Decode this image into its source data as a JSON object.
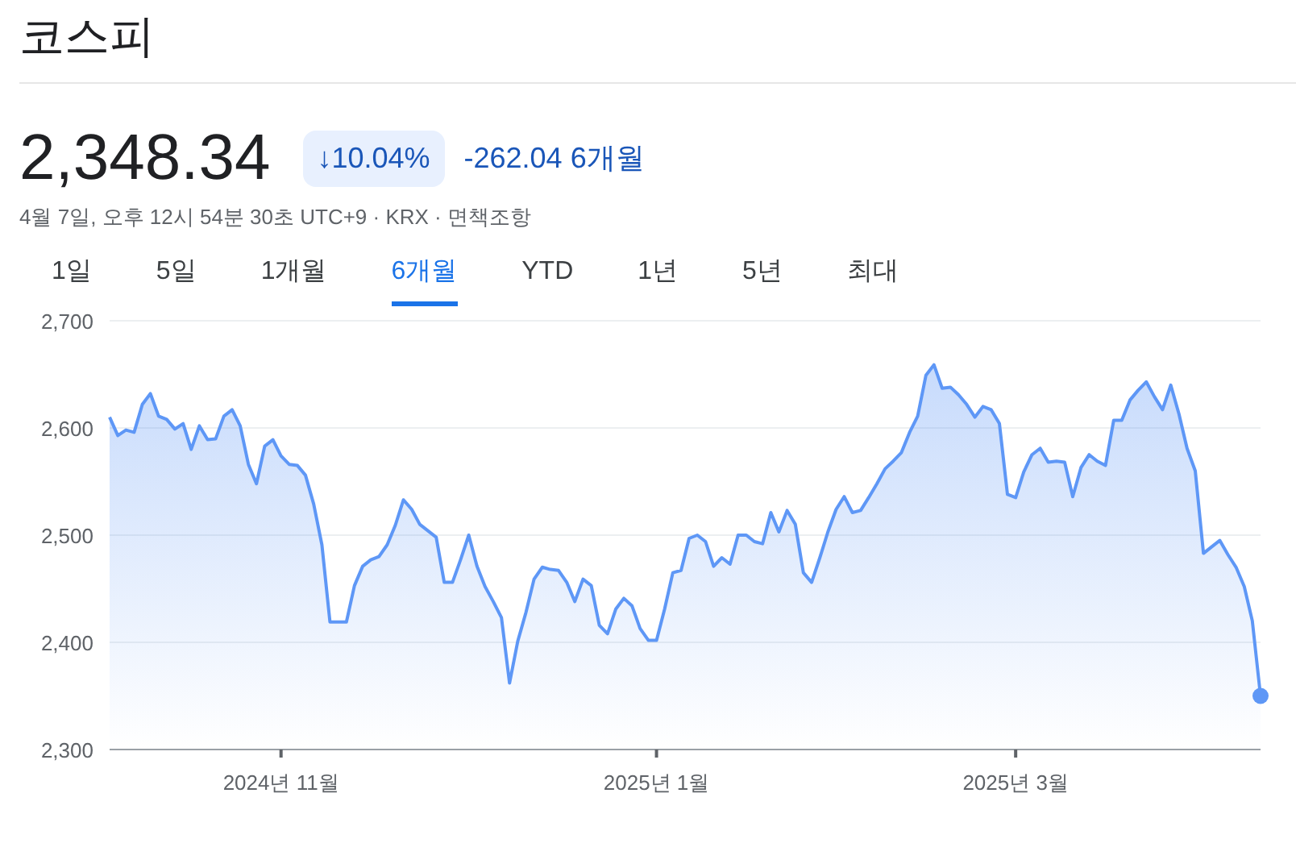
{
  "title": "코스피",
  "price": "2,348.34",
  "change_badge": {
    "arrow": "↓",
    "percent": "10.04%"
  },
  "change": "-262.04 6개월",
  "meta": "4월 7일, 오후 12시 54분 30초 UTC+9 · KRX · 면책조항",
  "tabs": [
    {
      "label": "1일",
      "selected": false
    },
    {
      "label": "5일",
      "selected": false
    },
    {
      "label": "1개월",
      "selected": false
    },
    {
      "label": "6개월",
      "selected": true
    },
    {
      "label": "YTD",
      "selected": false
    },
    {
      "label": "1년",
      "selected": false
    },
    {
      "label": "5년",
      "selected": false
    },
    {
      "label": "최대",
      "selected": false
    }
  ],
  "chart": {
    "chart_data": {
      "type": "area",
      "categories": [
        null,
        null,
        null,
        null,
        null,
        null,
        null,
        null,
        null,
        null,
        null,
        null,
        null,
        null,
        null,
        null,
        null,
        null,
        null,
        null,
        null,
        "2024년 11월",
        null,
        null,
        null,
        null,
        null,
        null,
        null,
        null,
        null,
        null,
        null,
        null,
        null,
        null,
        null,
        null,
        null,
        null,
        null,
        null,
        null,
        null,
        null,
        null,
        null,
        null,
        null,
        null,
        null,
        null,
        null,
        null,
        null,
        null,
        null,
        null,
        null,
        null,
        null,
        null,
        null,
        null,
        null,
        null,
        null,
        "2025년 1월",
        null,
        null,
        null,
        null,
        null,
        null,
        null,
        null,
        null,
        null,
        null,
        null,
        null,
        null,
        null,
        null,
        null,
        null,
        null,
        null,
        null,
        null,
        null,
        null,
        null,
        null,
        null,
        null,
        null,
        null,
        null,
        null,
        null,
        null,
        null,
        null,
        null,
        null,
        null,
        null,
        null,
        null,
        null,
        "2025년 3월",
        null,
        null,
        null,
        null,
        null,
        null,
        null,
        null,
        null,
        null,
        null,
        null,
        null,
        null,
        null,
        null,
        null,
        null,
        null,
        null,
        null,
        null,
        null,
        null,
        null,
        null,
        null,
        null,
        null,
        null
      ],
      "grid": true,
      "ylim": [
        2300,
        2700
      ],
      "yticks": [
        {
          "value": 2300,
          "label": "2,300"
        },
        {
          "value": 2400,
          "label": "2,400"
        },
        {
          "value": 2500,
          "label": "2,500"
        },
        {
          "value": 2600,
          "label": "2,600"
        },
        {
          "value": 2700,
          "label": "2,700"
        }
      ],
      "series": [
        {
          "color": "#5e97f6",
          "values": [
            2610,
            2593,
            2598,
            2596,
            2622,
            2632,
            2611,
            2608,
            2599,
            2604,
            2580,
            2602,
            2589,
            2590,
            2611,
            2617,
            2602,
            2566,
            2548,
            2583,
            2589,
            2574,
            2566,
            2565,
            2556,
            2529,
            2491,
            2419,
            2419,
            2419,
            2453,
            2471,
            2477,
            2480,
            2491,
            2509,
            2533,
            2524,
            2510,
            2504,
            2498,
            2456,
            2456,
            2477,
            2500,
            2471,
            2452,
            2438,
            2423,
            2362,
            2401,
            2428,
            2459,
            2470,
            2468,
            2467,
            2456,
            2438,
            2459,
            2453,
            2416,
            2408,
            2431,
            2441,
            2434,
            2413,
            2402,
            2402,
            2431,
            2465,
            2467,
            2497,
            2500,
            2494,
            2471,
            2479,
            2473,
            2500,
            2500,
            2494,
            2492,
            2521,
            2503,
            2523,
            2510,
            2465,
            2456,
            2479,
            2503,
            2524,
            2536,
            2521,
            2523,
            2535,
            2548,
            2562,
            2569,
            2577,
            2596,
            2611,
            2649,
            2659,
            2637,
            2638,
            2631,
            2622,
            2610,
            2620,
            2617,
            2604,
            2538,
            2535,
            2559,
            2575,
            2581,
            2568,
            2569,
            2568,
            2536,
            2563,
            2575,
            2569,
            2565,
            2607,
            2607,
            2626,
            2635,
            2643,
            2629,
            2617,
            2640,
            2613,
            2581,
            2560,
            2483,
            2489,
            2495,
            2482,
            2470,
            2452,
            2420,
            2350
          ]
        }
      ]
    }
  }
}
